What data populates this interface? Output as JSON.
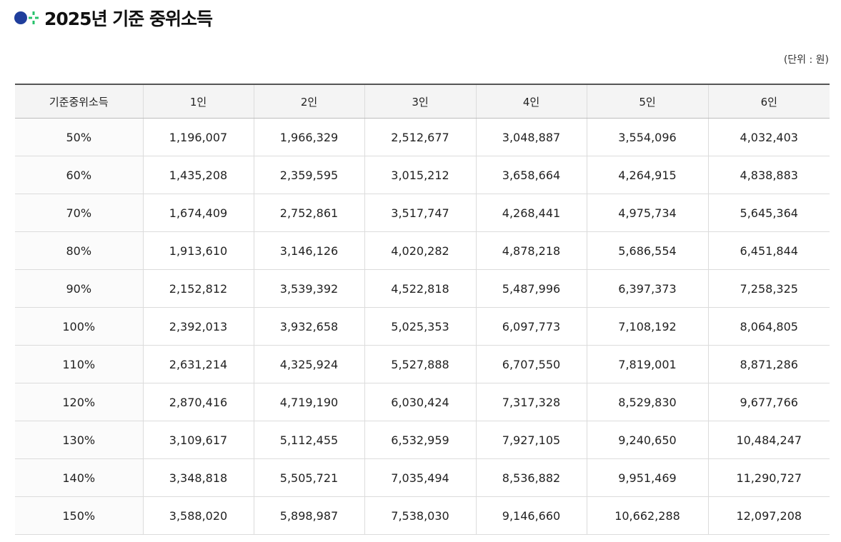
{
  "title": "2025년 기준 중위소득",
  "icon": "blue-dot-green-plus-icon",
  "colors": {
    "icon_blue": "#1f3e9c",
    "icon_green": "#27c26b",
    "header_bg": "#f4f4f4"
  },
  "unit_label": "(단위 : 원)",
  "table": {
    "headers": [
      "기준중위소득",
      "1인",
      "2인",
      "3인",
      "4인",
      "5인",
      "6인"
    ],
    "rows": [
      [
        "50%",
        "1,196,007",
        "1,966,329",
        "2,512,677",
        "3,048,887",
        "3,554,096",
        "4,032,403"
      ],
      [
        "60%",
        "1,435,208",
        "2,359,595",
        "3,015,212",
        "3,658,664",
        "4,264,915",
        "4,838,883"
      ],
      [
        "70%",
        "1,674,409",
        "2,752,861",
        "3,517,747",
        "4,268,441",
        "4,975,734",
        "5,645,364"
      ],
      [
        "80%",
        "1,913,610",
        "3,146,126",
        "4,020,282",
        "4,878,218",
        "5,686,554",
        "6,451,844"
      ],
      [
        "90%",
        "2,152,812",
        "3,539,392",
        "4,522,818",
        "5,487,996",
        "6,397,373",
        "7,258,325"
      ],
      [
        "100%",
        "2,392,013",
        "3,932,658",
        "5,025,353",
        "6,097,773",
        "7,108,192",
        "8,064,805"
      ],
      [
        "110%",
        "2,631,214",
        "4,325,924",
        "5,527,888",
        "6,707,550",
        "7,819,001",
        "8,871,286"
      ],
      [
        "120%",
        "2,870,416",
        "4,719,190",
        "6,030,424",
        "7,317,328",
        "8,529,830",
        "9,677,766"
      ],
      [
        "130%",
        "3,109,617",
        "5,112,455",
        "6,532,959",
        "7,927,105",
        "9,240,650",
        "10,484,247"
      ],
      [
        "140%",
        "3,348,818",
        "5,505,721",
        "7,035,494",
        "8,536,882",
        "9,951,469",
        "11,290,727"
      ],
      [
        "150%",
        "3,588,020",
        "5,898,987",
        "7,538,030",
        "9,146,660",
        "10,662,288",
        "12,097,208"
      ]
    ]
  }
}
